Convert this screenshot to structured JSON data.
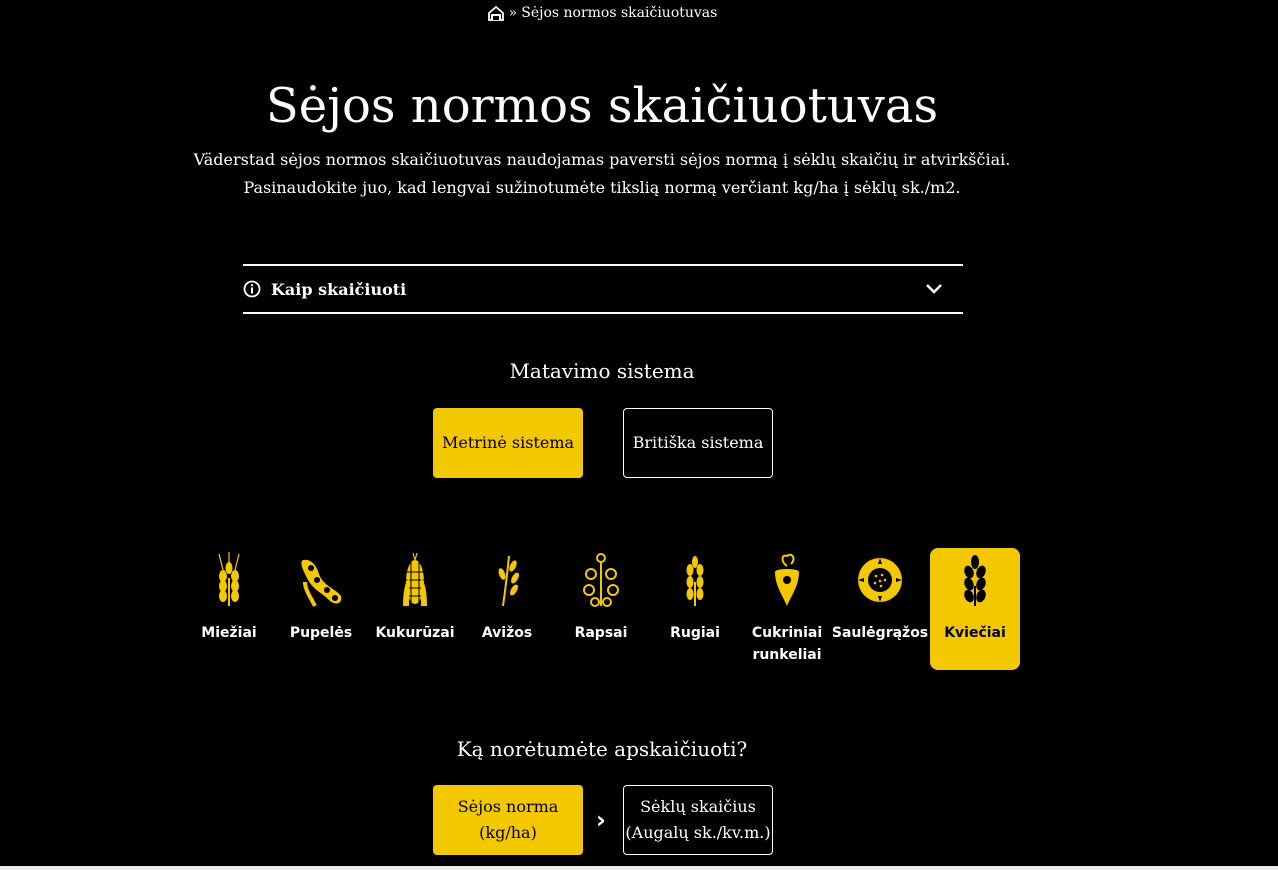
{
  "breadcrumb": {
    "separator": "»",
    "current": "Sėjos normos skaičiuotuvas"
  },
  "page": {
    "title": "Sėjos normos skaičiuotuvas",
    "intro_line1": "Väderstad sėjos normos skaičiuotuvas naudojamas paversti sėjos normą į sėklų skaičių ir atvirkščiai.",
    "intro_line2": "Pasinaudokite juo, kad lengvai sužinotumėte tikslią normą verčiant kg/ha į sėklų sk./m2."
  },
  "accordion": {
    "label": "Kaip skaičiuoti",
    "icon": "info-icon"
  },
  "measurement": {
    "title": "Matavimo sistema",
    "options": [
      {
        "label": "Metrinė sistema",
        "selected": true
      },
      {
        "label": "Britiška sistema",
        "selected": false
      }
    ]
  },
  "crops": [
    {
      "line1": "Miežiai",
      "line2": "",
      "icon": "barley-icon",
      "selected": false
    },
    {
      "line1": "Pupelės",
      "line2": "",
      "icon": "beans-icon",
      "selected": false
    },
    {
      "line1": "Kukurūzai",
      "line2": "",
      "icon": "corn-icon",
      "selected": false
    },
    {
      "line1": "Avižos",
      "line2": "",
      "icon": "oats-icon",
      "selected": false
    },
    {
      "line1": "Rapsai",
      "line2": "",
      "icon": "rapeseed-icon",
      "selected": false
    },
    {
      "line1": "Rugiai",
      "line2": "",
      "icon": "rye-icon",
      "selected": false
    },
    {
      "line1": "Cukriniai",
      "line2": "runkeliai",
      "icon": "sugar-beet-icon",
      "selected": false
    },
    {
      "line1": "Saulėgrąžos",
      "line2": "",
      "icon": "sunflower-icon",
      "selected": false
    },
    {
      "line1": "Kviečiai",
      "line2": "",
      "icon": "wheat-icon",
      "selected": true
    }
  ],
  "calculate": {
    "title": "Ką norėtumėte apskaičiuoti?",
    "separator": "›",
    "options": [
      {
        "line1": "Sėjos norma",
        "line2": "(kg/ha)",
        "selected": true
      },
      {
        "line1": "Sėklų skaičius",
        "line2": "(Augalų sk./kv.m.)",
        "selected": false
      }
    ]
  },
  "colors": {
    "accent": "#f3c800",
    "background": "#000000",
    "text": "#ffffff"
  }
}
